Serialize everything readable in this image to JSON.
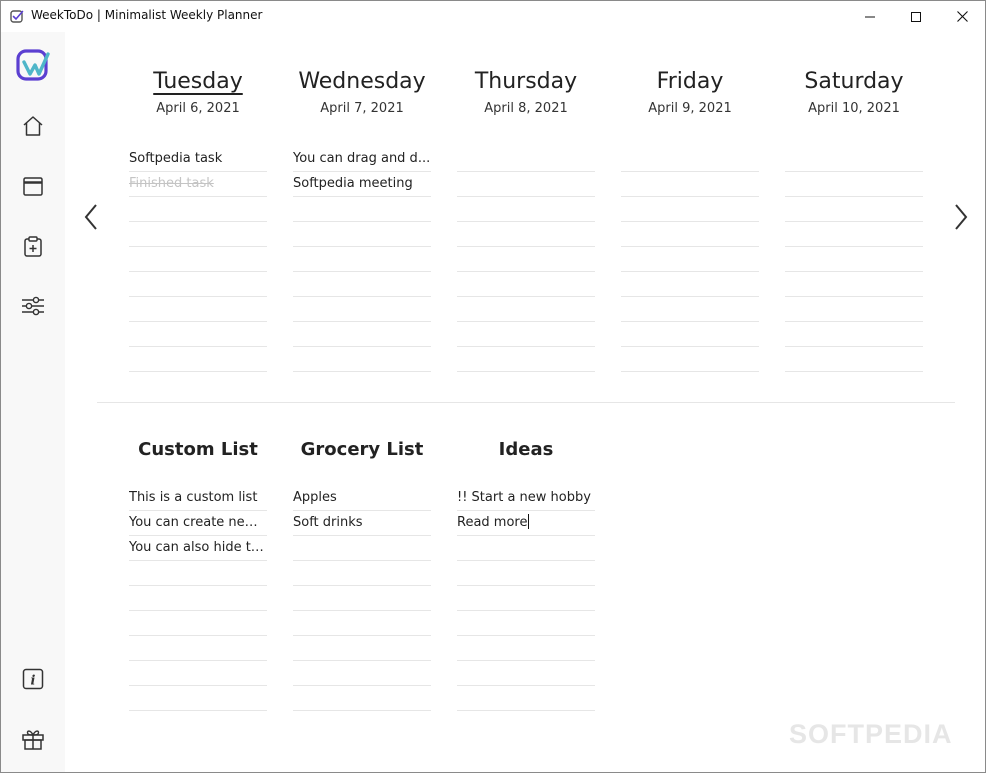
{
  "window": {
    "title": "WeekToDo | Minimalist Weekly Planner",
    "controls": [
      "minimize",
      "maximize",
      "close"
    ]
  },
  "sidebar": {
    "logo": "weektodo-logo",
    "items": [
      {
        "icon": "home-icon"
      },
      {
        "icon": "calendar-icon"
      },
      {
        "icon": "clipboard-add-icon"
      },
      {
        "icon": "settings-sliders-icon"
      }
    ],
    "bottom_items": [
      {
        "icon": "info-icon"
      },
      {
        "icon": "gift-icon"
      }
    ]
  },
  "days": [
    {
      "name": "Tuesday",
      "date": "April 6, 2021",
      "today": true,
      "tasks": [
        {
          "text": "Softpedia task",
          "done": false
        },
        {
          "text": "Finished task",
          "done": true
        }
      ]
    },
    {
      "name": "Wednesday",
      "date": "April 7, 2021",
      "today": false,
      "tasks": [
        {
          "text": "You can drag and d...",
          "done": false
        },
        {
          "text": "Softpedia meeting",
          "done": false
        }
      ]
    },
    {
      "name": "Thursday",
      "date": "April 8, 2021",
      "today": false,
      "tasks": []
    },
    {
      "name": "Friday",
      "date": "April 9, 2021",
      "today": false,
      "tasks": []
    },
    {
      "name": "Saturday",
      "date": "April 10, 2021",
      "today": false,
      "tasks": []
    }
  ],
  "lists": [
    {
      "name": "Custom List",
      "tasks": [
        {
          "text": "This is a custom list"
        },
        {
          "text": "You can create new ..."
        },
        {
          "text": "You can also hide th..."
        }
      ]
    },
    {
      "name": "Grocery List",
      "tasks": [
        {
          "text": "Apples"
        },
        {
          "text": "Soft drinks"
        }
      ]
    },
    {
      "name": "Ideas",
      "tasks": [
        {
          "text": "!! Start a new hobby"
        },
        {
          "text": "Read more",
          "editing": true
        }
      ]
    }
  ],
  "watermark": "SOFTPEDIA",
  "colors": {
    "logo_purple": "#5b3fd1",
    "logo_teal": "#4fb6c9",
    "done_text": "#c4c4c4",
    "row_line": "#e6e6e6",
    "sidebar_bg": "#f8f8f8"
  }
}
